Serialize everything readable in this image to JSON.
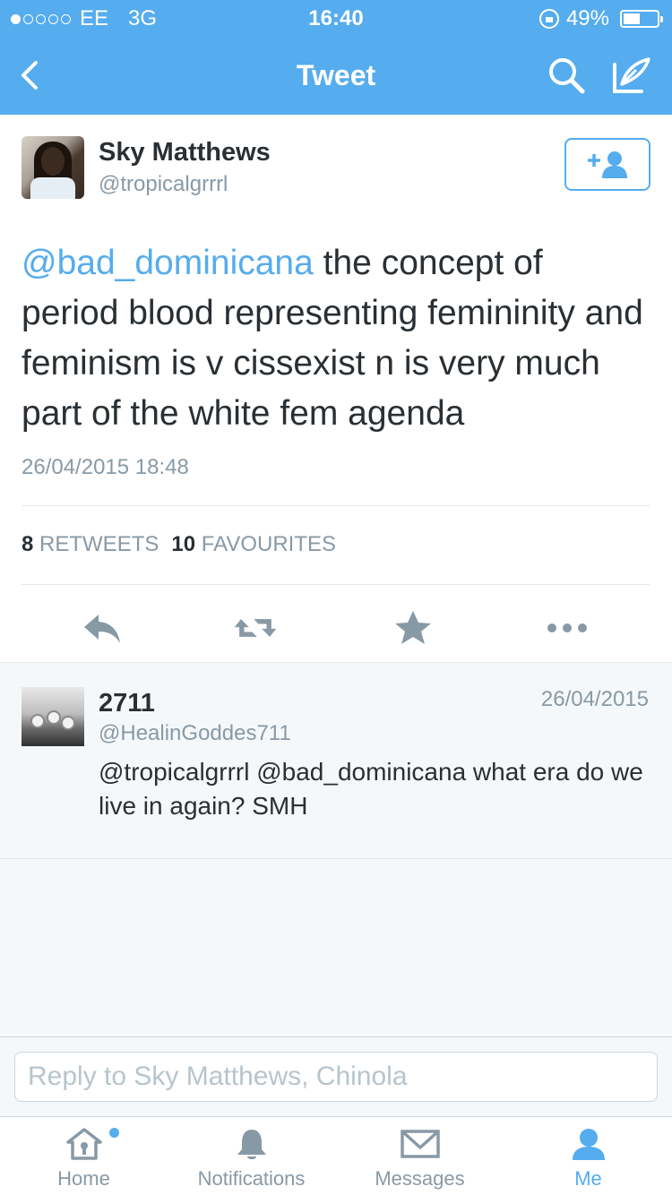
{
  "status_bar": {
    "carrier": "EE",
    "network": "3G",
    "time": "16:40",
    "battery_percent": "49%",
    "battery_level": 0.49
  },
  "nav": {
    "title": "Tweet"
  },
  "tweet": {
    "name": "Sky Matthews",
    "handle": "@tropicalgrrrl",
    "mention": "@bad_dominicana",
    "text": " the concept of period blood representing femininity and feminism is v cissexist n is very much part of the white fem agenda",
    "date": "26/04/2015 18:48",
    "retweets_count": "8",
    "retweets_label": "RETWEETS",
    "favourites_count": "10",
    "favourites_label": "FAVOURITES"
  },
  "reply": {
    "name": "2711",
    "handle": "@HealinGoddes711",
    "date": "26/04/2015",
    "text": "@tropicalgrrrl @bad_dominicana what era do we live in again? SMH"
  },
  "composer": {
    "placeholder": "Reply to Sky Matthews, Chinola"
  },
  "tabs": [
    {
      "label": "Home",
      "icon": "home-icon"
    },
    {
      "label": "Notifications",
      "icon": "bell-icon"
    },
    {
      "label": "Messages",
      "icon": "envelope-icon"
    },
    {
      "label": "Me",
      "icon": "person-icon"
    }
  ],
  "colors": {
    "accent": "#55acee",
    "text": "#292f33",
    "muted": "#8899a6",
    "action_icon": "#8899a6"
  }
}
